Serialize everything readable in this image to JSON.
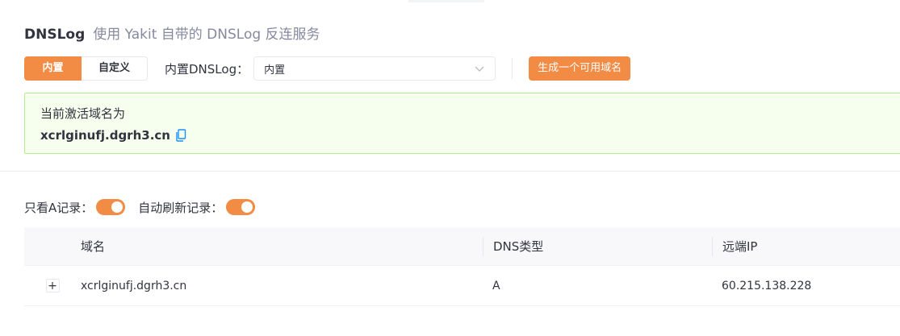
{
  "header": {
    "title": "DNSLog",
    "subtitle": "使用 Yakit 自带的 DNSLog 反连服务"
  },
  "controls": {
    "mode_tabs": [
      {
        "label": "内置",
        "active": true
      },
      {
        "label": "自定义",
        "active": false
      }
    ],
    "dnslog_label": "内置DNSLog：",
    "dnslog_select_value": "内置",
    "generate_button": "生成一个可用域名"
  },
  "alert": {
    "line1": "当前激活域名为",
    "domain": "xcrlginufj.dgrh3.cn"
  },
  "filters": {
    "only_a_label": "只看A记录：",
    "only_a_on": true,
    "auto_refresh_label": "自动刷新记录：",
    "auto_refresh_on": true
  },
  "table": {
    "columns": [
      "域名",
      "DNS类型",
      "远端IP"
    ],
    "rows": [
      {
        "expand": "+",
        "domain": "xcrlginufj.dgrh3.cn",
        "type": "A",
        "ip": "60.215.138.228"
      }
    ]
  },
  "colors": {
    "accent": "#f28b44",
    "alert_bg": "#f6ffed",
    "alert_border": "#b7eb8f",
    "copy_icon": "#1890ff"
  }
}
